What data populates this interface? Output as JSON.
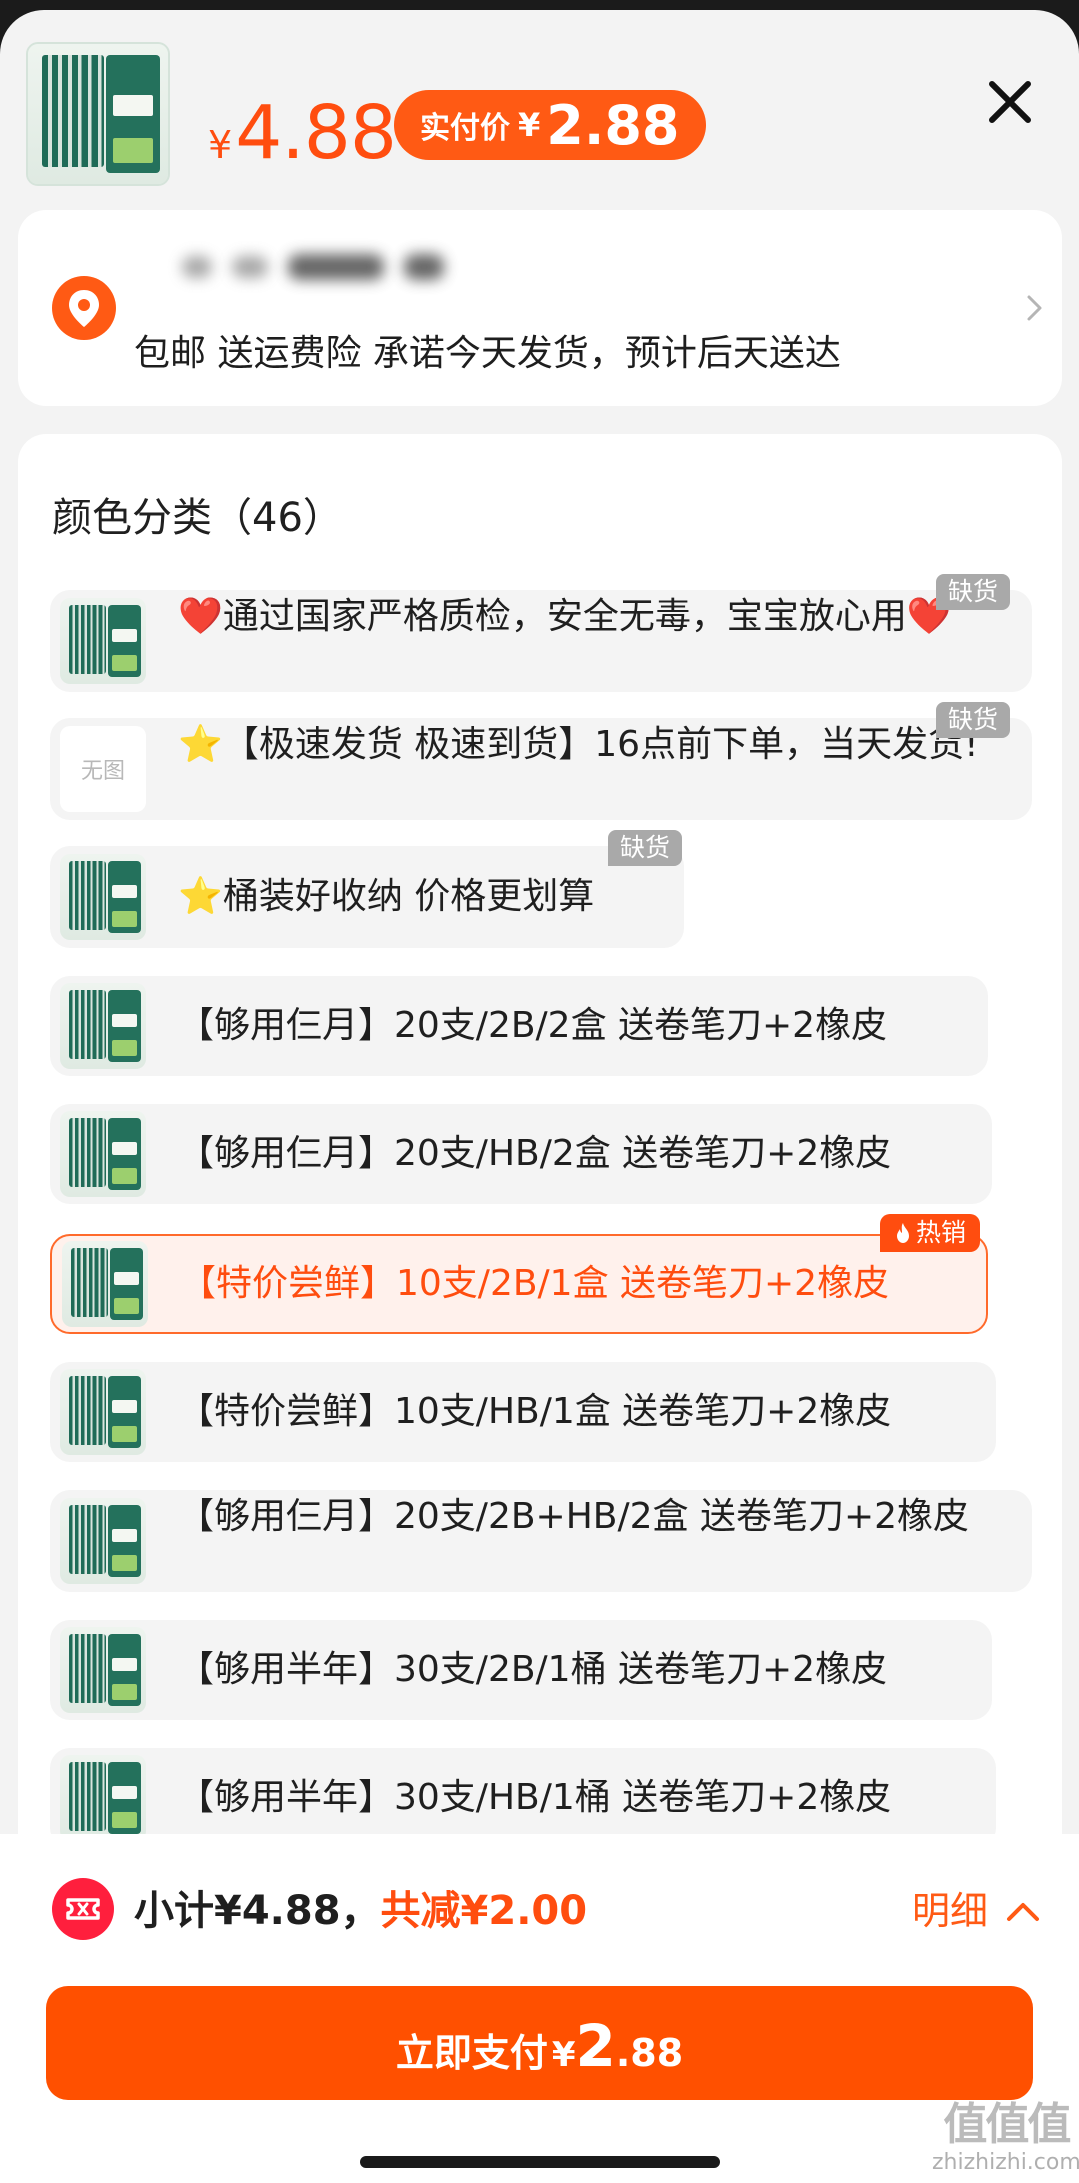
{
  "header": {
    "price_currency": "¥",
    "price": "4.88",
    "actual_label": "实付价",
    "actual_currency": "¥",
    "actual_price": "2.88"
  },
  "address": {
    "delivery_text": "包邮 送运费险 承诺今天发货，预计后天送达"
  },
  "variants": {
    "title": "颜色分类（46）",
    "items": [
      {
        "text": "❤️通过国家严格质检，安全无毒，宝宝放心用❤️",
        "badge": "缺货",
        "thumb": "image"
      },
      {
        "text": "⭐【极速发货 极速到货】16点前下单，当天发货!",
        "badge": "缺货",
        "thumb": "无图"
      },
      {
        "text": "⭐桶装好收纳 价格更划算",
        "badge": "缺货",
        "thumb": "image"
      },
      {
        "text": "【够用仨月】20支/2B/2盒 送卷笔刀+2橡皮",
        "thumb": "image"
      },
      {
        "text": "【够用仨月】20支/HB/2盒 送卷笔刀+2橡皮",
        "thumb": "image"
      },
      {
        "text": "【特价尝鲜】10支/2B/1盒 送卷笔刀+2橡皮",
        "badge": "热销",
        "selected": true,
        "thumb": "image"
      },
      {
        "text": "【特价尝鲜】10支/HB/1盒 送卷笔刀+2橡皮",
        "thumb": "image"
      },
      {
        "text": "【够用仨月】20支/2B+HB/2盒 送卷笔刀+2橡皮",
        "thumb": "image"
      },
      {
        "text": "【够用半年】30支/2B/1桶 送卷笔刀+2橡皮",
        "thumb": "image"
      },
      {
        "text": "【够用半年】30支/HB/1桶 送卷笔刀+2橡皮",
        "thumb": "image"
      }
    ]
  },
  "footer": {
    "subtotal": "小计¥4.88，",
    "saved": "共减¥2.00",
    "detail": "明细",
    "pay_label": "立即支付",
    "pay_currency": "¥",
    "pay_int": "2",
    "pay_dec": ".88"
  },
  "watermark": {
    "logo": "值值值",
    "site": "zhizhizhi.com"
  },
  "colors": {
    "accent": "#ff5000",
    "price": "#ff4d0f",
    "out_of_stock_badge": "#a9a9a9"
  }
}
